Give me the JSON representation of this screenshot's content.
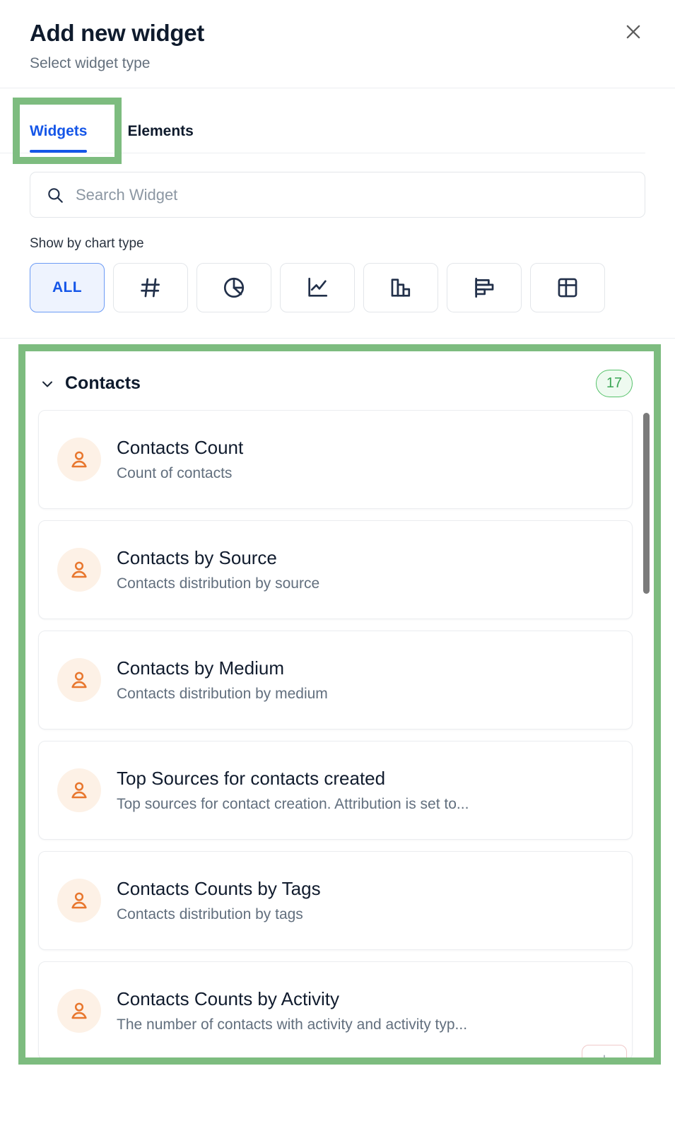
{
  "dialog": {
    "title": "Add new widget",
    "subtitle": "Select widget type",
    "close_label": "close-icon"
  },
  "tabs": [
    {
      "label": "Widgets",
      "active": true
    },
    {
      "label": "Elements",
      "active": false
    }
  ],
  "search": {
    "placeholder": "Search Widget",
    "value": "",
    "icon": "search-icon"
  },
  "filter": {
    "label": "Show by chart type",
    "chips": [
      {
        "id": "all",
        "label": "ALL",
        "icon": "all-text",
        "selected": true
      },
      {
        "id": "number",
        "label": "",
        "icon": "hash-icon",
        "selected": false
      },
      {
        "id": "pie",
        "label": "",
        "icon": "pie-chart-icon",
        "selected": false
      },
      {
        "id": "line",
        "label": "",
        "icon": "line-chart-icon",
        "selected": false
      },
      {
        "id": "column",
        "label": "",
        "icon": "column-chart-icon",
        "selected": false
      },
      {
        "id": "bar",
        "label": "",
        "icon": "bar-chart-icon",
        "selected": false
      },
      {
        "id": "table",
        "label": "",
        "icon": "table-icon",
        "selected": false
      }
    ]
  },
  "results": {
    "group": {
      "title": "Contacts",
      "count": "17",
      "chevron": "chevron-down-icon",
      "expanded": true
    },
    "items": [
      {
        "name": "Contacts Count",
        "desc": "Count of contacts",
        "icon": "contact-person-icon"
      },
      {
        "name": "Contacts by Source",
        "desc": "Contacts distribution by source",
        "icon": "contact-person-icon"
      },
      {
        "name": "Contacts by Medium",
        "desc": "Contacts distribution by medium",
        "icon": "contact-person-icon"
      },
      {
        "name": "Top Sources for contacts created",
        "desc": "Top sources for contact creation. Attribution is set to...",
        "icon": "contact-person-icon"
      },
      {
        "name": "Contacts Counts by Tags",
        "desc": "Contacts distribution by tags",
        "icon": "contact-person-icon"
      },
      {
        "name": "Contacts Counts by Activity",
        "desc": "The number of contacts with activity and activity typ...",
        "icon": "contact-person-icon"
      }
    ],
    "scroll_down_icon": "arrow-down-icon"
  },
  "colors": {
    "accent_blue": "#1556e8",
    "highlight_green": "#7dbc7f",
    "badge_green": "#3aa554",
    "avatar_orange": "#e8772e",
    "text_dark": "#0f1b2d",
    "text_muted": "#626f7e"
  }
}
